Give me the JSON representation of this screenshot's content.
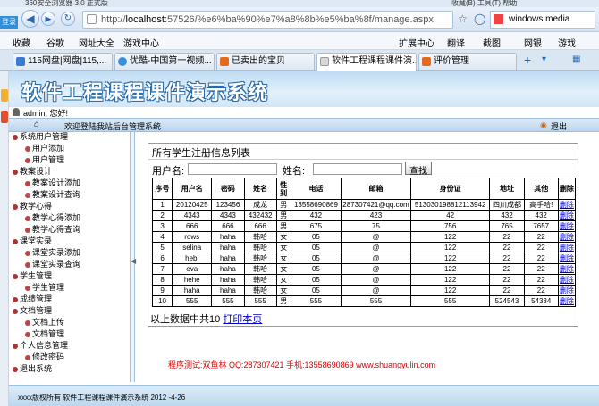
{
  "browser": {
    "title": "360安全浏览器 3.0 正式版",
    "title_right": "收藏(B)  工具(T)  帮助",
    "address_prefix": "http://",
    "address_host": "localhost",
    "address_rest": ":57526/%e6%ba%90%e7%a8%8b%e5%ba%8f/manage.aspx",
    "search_text": "windows media",
    "login_label": "登录",
    "favorites": [
      "收藏",
      "谷歌",
      "网址大全",
      "游戏中心"
    ],
    "right_tools": [
      "扩展中心",
      "翻译",
      "截图",
      "网银",
      "游戏"
    ],
    "tabs": [
      {
        "label": "115网盘|网盘|115,..."
      },
      {
        "label": "优酷-中国第一视频..."
      },
      {
        "label": "已卖出的宝贝"
      },
      {
        "label": "软件工程课程课件演..."
      },
      {
        "label": "评价管理"
      }
    ]
  },
  "app": {
    "title": "软件工程课程课件演示系统",
    "user": "admin, 您好!",
    "welcome": "欢迎登陆我站后台管理系统",
    "logout": "退出"
  },
  "tree": [
    {
      "label": "系统用户管理",
      "level": 0
    },
    {
      "label": "用户添加",
      "level": 1
    },
    {
      "label": "用户管理",
      "level": 1
    },
    {
      "label": "教案设计",
      "level": 0
    },
    {
      "label": "教案设计添加",
      "level": 1
    },
    {
      "label": "教案设计查询",
      "level": 1
    },
    {
      "label": "教学心得",
      "level": 0
    },
    {
      "label": "教学心得添加",
      "level": 1
    },
    {
      "label": "教学心得查询",
      "level": 1
    },
    {
      "label": "课堂实录",
      "level": 0
    },
    {
      "label": "课堂实录添加",
      "level": 1
    },
    {
      "label": "课堂实录查询",
      "level": 1
    },
    {
      "label": "学生管理",
      "level": 0
    },
    {
      "label": "学生管理",
      "level": 1
    },
    {
      "label": "成绩管理",
      "level": 0
    },
    {
      "label": "文档管理",
      "level": 0
    },
    {
      "label": "文档上传",
      "level": 1
    },
    {
      "label": "文档管理",
      "level": 1
    },
    {
      "label": "个人信息管理",
      "level": 0
    },
    {
      "label": "修改密码",
      "level": 1
    },
    {
      "label": "退出系统",
      "level": 0
    }
  ],
  "list": {
    "title": "所有学生注册信息列表",
    "username_label": "用户名:",
    "name_label": "姓名:",
    "query_button": "查找",
    "columns": [
      "序号",
      "用户名",
      "密码",
      "姓名",
      "性别",
      "电话",
      "邮箱",
      "身份证",
      "地址",
      "其他",
      "删除"
    ],
    "rows": [
      [
        "1",
        "20120425",
        "123456",
        "成龙",
        "男",
        "13558690869",
        "287307421@qq.com",
        "513030198812113942",
        "四川成都",
        "高手哈!",
        "删除"
      ],
      [
        "2",
        "4343",
        "4343",
        "432432",
        "男",
        "432",
        "423",
        "42",
        "432",
        "432",
        "删除"
      ],
      [
        "3",
        "666",
        "666",
        "666",
        "男",
        "675",
        "75",
        "756",
        "765",
        "7657",
        "删除"
      ],
      [
        "4",
        "rows",
        "haha",
        "韩哈",
        "女",
        "05",
        "@",
        "122",
        "22",
        "22",
        "删除"
      ],
      [
        "5",
        "selina",
        "haha",
        "韩哈",
        "女",
        "05",
        "@",
        "122",
        "22",
        "22",
        "删除"
      ],
      [
        "6",
        "hebi",
        "haha",
        "韩哈",
        "女",
        "05",
        "@",
        "122",
        "22",
        "22",
        "删除"
      ],
      [
        "7",
        "eva",
        "haha",
        "韩哈",
        "女",
        "05",
        "@",
        "122",
        "22",
        "22",
        "删除"
      ],
      [
        "8",
        "hehe",
        "haha",
        "韩哈",
        "女",
        "05",
        "@",
        "122",
        "22",
        "22",
        "删除"
      ],
      [
        "9",
        "haha",
        "haha",
        "韩哈",
        "女",
        "05",
        "@",
        "122",
        "22",
        "22",
        "删除"
      ],
      [
        "10",
        "555",
        "555",
        "555",
        "男",
        "555",
        "555",
        "555",
        "524543",
        "54334",
        "删除"
      ]
    ],
    "summary": "以上数据中共10",
    "print_link": "打印本页"
  },
  "credit": "程序测试:双鱼林 QQ:287307421 手机:13558690869 www.shuangyulin.com",
  "footer": "xxxx版权所有 软件工程课程课件演示系统 2012 -4-26"
}
